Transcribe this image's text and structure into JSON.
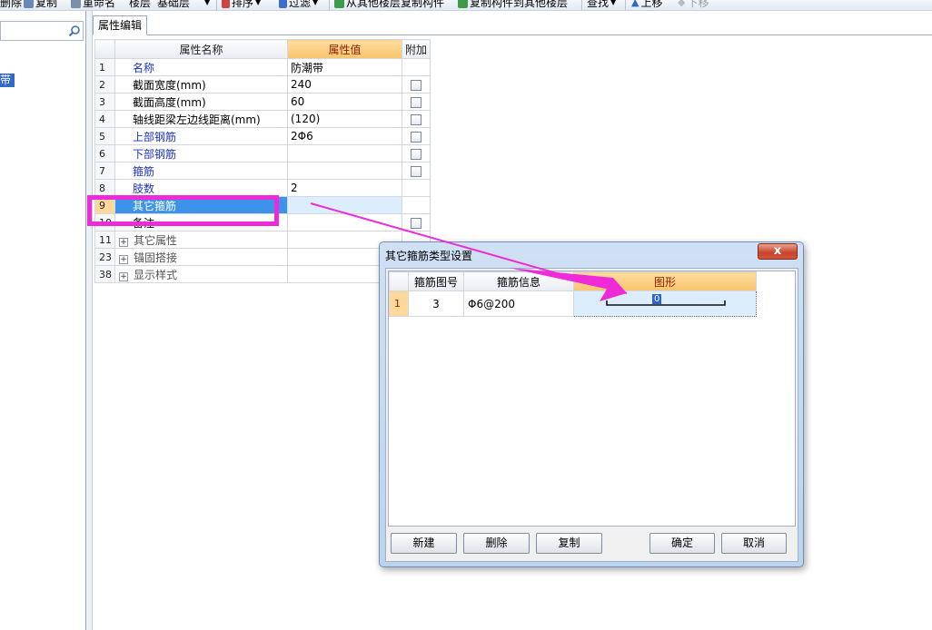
{
  "toolbar": {
    "items": [
      {
        "label": "删除",
        "icon": "delete-icon"
      },
      {
        "label": "复制",
        "icon": "copy-icon"
      },
      {
        "label": "重命名",
        "icon": "rename-icon"
      },
      {
        "label": "楼层",
        "icon": ""
      },
      {
        "label": "基础层",
        "icon": ""
      },
      {
        "label": "排序",
        "icon": "sort-icon"
      },
      {
        "label": "过滤",
        "icon": "filter-icon"
      },
      {
        "label": "从其他楼层复制构件",
        "icon": "copy-from-floor-icon"
      },
      {
        "label": "复制构件到其他楼层",
        "icon": "copy-to-floor-icon"
      },
      {
        "label": "查找",
        "icon": ""
      },
      {
        "label": "上移",
        "icon": "move-up-icon"
      },
      {
        "label": "下移",
        "icon": "move-down-icon"
      }
    ]
  },
  "left_panel": {
    "search_placeholder": "",
    "selected_item_fragment": "带"
  },
  "tab": {
    "label": "属性编辑"
  },
  "property_grid": {
    "headers": {
      "name": "属性名称",
      "value": "属性值",
      "extra": "附加"
    },
    "rows": [
      {
        "num": "1",
        "name": "名称",
        "value": "防潮带",
        "checkbox": false,
        "blue": true
      },
      {
        "num": "2",
        "name": "截面宽度(mm)",
        "value": "240",
        "checkbox": true,
        "blue": false
      },
      {
        "num": "3",
        "name": "截面高度(mm)",
        "value": "60",
        "checkbox": true,
        "blue": false
      },
      {
        "num": "4",
        "name": "轴线距梁左边线距离(mm)",
        "value": "(120)",
        "checkbox": true,
        "blue": false
      },
      {
        "num": "5",
        "name": "上部钢筋",
        "value": "2Φ6",
        "checkbox": true,
        "blue": true
      },
      {
        "num": "6",
        "name": "下部钢筋",
        "value": "",
        "checkbox": true,
        "blue": true
      },
      {
        "num": "7",
        "name": "箍筋",
        "value": "",
        "checkbox": true,
        "blue": true
      },
      {
        "num": "8",
        "name": "肢数",
        "value": "2",
        "checkbox": false,
        "blue": true
      },
      {
        "num": "9",
        "name": "其它箍筋",
        "value": "",
        "checkbox": false,
        "blue": false,
        "selected": true
      },
      {
        "num": "10",
        "name": "备注",
        "value": "",
        "checkbox": true,
        "blue": false
      },
      {
        "num": "11",
        "name": "其它属性",
        "value": "",
        "checkbox": false,
        "blue": false,
        "group": true
      },
      {
        "num": "23",
        "name": "锚固搭接",
        "value": "",
        "checkbox": false,
        "blue": false,
        "group": true
      },
      {
        "num": "38",
        "name": "显示样式",
        "value": "",
        "checkbox": false,
        "blue": false,
        "group": true
      }
    ]
  },
  "dialog": {
    "title": "其它箍筋类型设置",
    "close_label": "x",
    "headers": {
      "shape_no": "箍筋图号",
      "info": "箍筋信息",
      "shape": "图形"
    },
    "rows": [
      {
        "num": "1",
        "shape_no": "3",
        "info": "Φ6@200",
        "shape_value": "0"
      }
    ],
    "buttons": {
      "new": "新建",
      "delete": "删除",
      "copy": "复制",
      "ok": "确定",
      "cancel": "取消"
    }
  },
  "colors": {
    "highlight": "#ee2ad9",
    "arrow": "#ee2ad9",
    "selected_row": "#3b93ea",
    "header_orange": "#f8c56c"
  }
}
